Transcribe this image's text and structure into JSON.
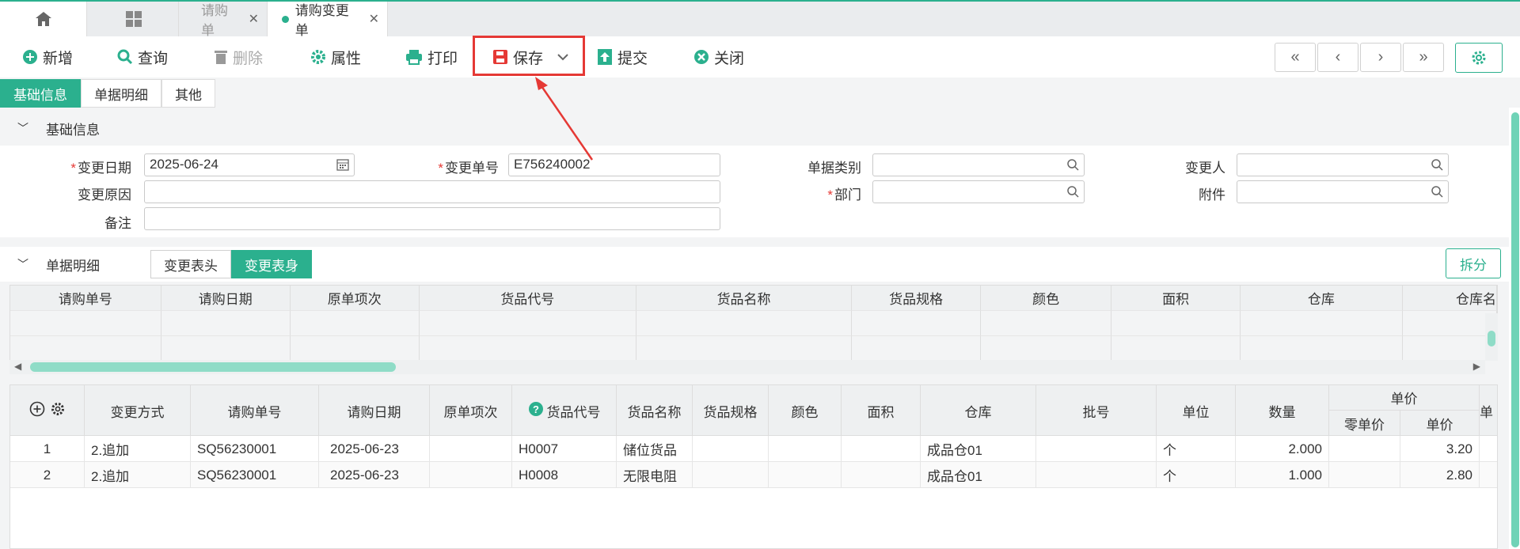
{
  "tabs": {
    "items": [
      {
        "label": "请购单"
      },
      {
        "label": "请购变更单"
      }
    ]
  },
  "toolbar": {
    "new": "新增",
    "query": "查询",
    "delete": "删除",
    "props": "属性",
    "print": "打印",
    "save": "保存",
    "submit": "提交",
    "close": "关闭"
  },
  "subtabs": [
    "基础信息",
    "单据明细",
    "其他"
  ],
  "basic_section": {
    "title": "基础信息"
  },
  "form": {
    "change_date_label": "变更日期",
    "change_date_value": "2025-06-24",
    "change_no_label": "变更单号",
    "change_no_value": "E756240002",
    "doc_type_label": "单据类别",
    "changer_label": "变更人",
    "reason_label": "变更原因",
    "dept_label": "部门",
    "attach_label": "附件",
    "remark_label": "备注"
  },
  "detail_section": {
    "title": "单据明细",
    "toggle": [
      "变更表头",
      "变更表身"
    ],
    "split": "拆分"
  },
  "grid1": {
    "headers": [
      "请购单号",
      "请购日期",
      "原单项次",
      "货品代号",
      "货品名称",
      "货品规格",
      "颜色",
      "面积",
      "仓库",
      "仓库名"
    ]
  },
  "grid2": {
    "headers": [
      "变更方式",
      "请购单号",
      "请购日期",
      "原单项次",
      "货品代号",
      "货品名称",
      "货品规格",
      "颜色",
      "面积",
      "仓库",
      "批号",
      "单位",
      "数量"
    ],
    "price_group": "单价",
    "price_sub": [
      "零单价",
      "单价"
    ],
    "extra_head": "单",
    "rows": [
      {
        "no": "1",
        "method": "2.追加",
        "po": "SQ56230001",
        "date": "2025-06-23",
        "item": "",
        "code": "H0007",
        "name": "储位货品",
        "spec": "",
        "color": "",
        "area": "",
        "wh": "成品仓01",
        "lot": "",
        "unit": "个",
        "qty": "2.000",
        "zero": "",
        "price": "3.20"
      },
      {
        "no": "2",
        "method": "2.追加",
        "po": "SQ56230001",
        "date": "2025-06-23",
        "item": "",
        "code": "H0008",
        "name": "无限电阻",
        "spec": "",
        "color": "",
        "area": "",
        "wh": "成品仓01",
        "lot": "",
        "unit": "个",
        "qty": "1.000",
        "zero": "",
        "price": "2.80"
      }
    ]
  },
  "colors": {
    "accent": "#2bb08e",
    "highlight": "#e53935"
  }
}
